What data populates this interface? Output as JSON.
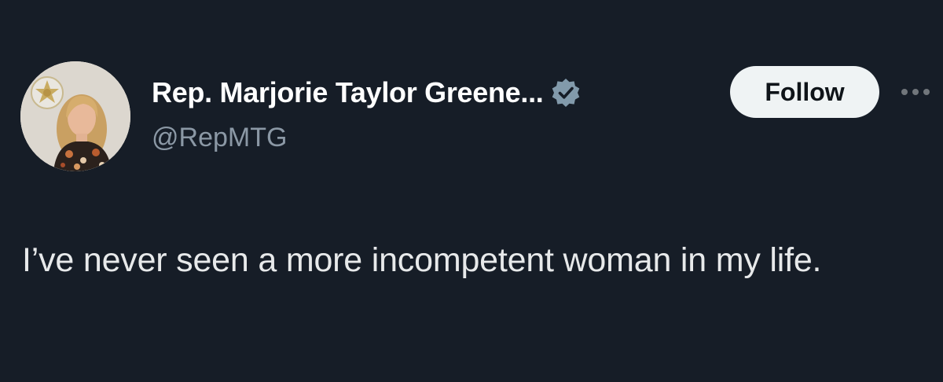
{
  "tweet": {
    "author": {
      "display_name": "Rep. Marjorie Taylor Greene...",
      "handle": "@RepMTG",
      "verified": true,
      "verified_badge_color": "#829aab",
      "avatar_icon": "profile-photo"
    },
    "follow_label": "Follow",
    "more_icon": "more-horizontal-icon",
    "text": "I’ve never seen a more incompetent woman in my life."
  },
  "colors": {
    "background": "#161d27",
    "primary_text": "#e7e9ea",
    "secondary_text": "#8b98a5",
    "follow_button_bg": "#eff3f4",
    "follow_button_text": "#0f1419"
  }
}
